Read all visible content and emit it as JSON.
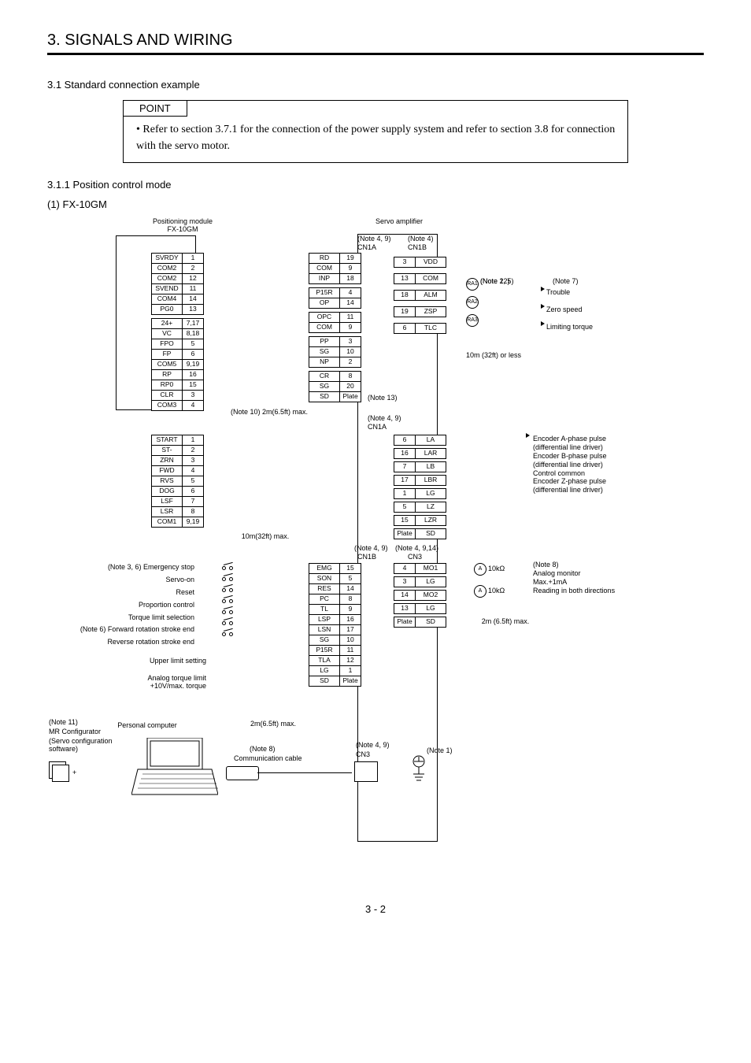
{
  "chapter_title": "3. SIGNALS AND WIRING",
  "section": "3.1 Standard connection example",
  "point": {
    "label": "POINT",
    "text": "Refer to section 3.7.1 for the connection of the power supply system and refer to section 3.8 for connection with the servo motor."
  },
  "subsection": "3.1.1 Position control mode",
  "device": "(1) FX-10GM",
  "page_footer": "3 - 2",
  "labels": {
    "positioning_module": "Positioning module\nFX-10GM",
    "servo_amplifier": "Servo amplifier",
    "note49a": "(Note 4, 9)",
    "note4": "(Note 4)",
    "cn1a": "CN1A",
    "cn1b": "CN1B",
    "note12": "(Note 12)",
    "note25": "(Note 2, 5)",
    "note7": "(Note 7)",
    "trouble": "Trouble",
    "zero_speed": "Zero speed",
    "limit_torque": "Limiting torque",
    "cable_top": "10m (32ft) or less",
    "note13": "(Note 13)",
    "note49b": "(Note 4, 9)",
    "note10_len": "(Note 10) 2m(6.5ft) max.",
    "ten_m": "10m(32ft) max.",
    "enc_a": "Encoder A-phase pulse",
    "diff": "(differential line driver)",
    "enc_b": "Encoder B-phase pulse",
    "ctrl_common": "Control common",
    "enc_z": "Encoder Z-phase pulse",
    "note36": "(Note 3, 6) Emergency stop",
    "servo_on": "Servo-on",
    "reset": "Reset",
    "prop": "Proportion control",
    "tlsel": "Torque limit selection",
    "note6_fwd": "(Note 6) Forward rotation stroke end",
    "rev_end": "Reverse rotation stroke end",
    "upper_limit": "Upper limit setting",
    "analog_tl": "Analog torque limit\n+10V/max. torque",
    "note49c": "(Note 4, 9)",
    "note4914": "(Note 4, 9,14)",
    "cn3": "CN3",
    "note8": "(Note 8)",
    "analog_mon": "Analog monitor",
    "max1ma": "Max.+1mA",
    "read_both": "Reading in both directions",
    "two_m": "2m (6.5ft) max.",
    "two_m_b": "2m(6.5ft) max.",
    "note11": "(Note 11)",
    "mrconf": "MR Configurator",
    "servo_conf": "(Servo configuration software)",
    "personal_computer": "Personal computer",
    "note8b": "(Note 8)",
    "comm_cable": "Communication cable",
    "note49d": "(Note 4, 9)",
    "note1": "(Note 1)",
    "ra1": "RA1",
    "ra2": "RA2",
    "ra3": "RA3",
    "a": "A",
    "ohm": "10kΩ",
    "plus": "+"
  },
  "left_rows": [
    {
      "sig": "SVRDY",
      "pin": "1"
    },
    {
      "sig": "COM2",
      "pin": "2"
    },
    {
      "sig": "COM2",
      "pin": "12"
    },
    {
      "sig": "SVEND",
      "pin": "11"
    },
    {
      "sig": "COM4",
      "pin": "14"
    },
    {
      "sig": "PG0",
      "pin": "13"
    },
    {
      "sig": "",
      "pin": ""
    },
    {
      "sig": "24+",
      "pin": "7,17"
    },
    {
      "sig": "VC",
      "pin": "8,18"
    },
    {
      "sig": "FPO",
      "pin": "5"
    },
    {
      "sig": "FP",
      "pin": "6"
    },
    {
      "sig": "COM5",
      "pin": "9,19"
    },
    {
      "sig": "RP",
      "pin": "16"
    },
    {
      "sig": "RP0",
      "pin": "15"
    },
    {
      "sig": "CLR",
      "pin": "3"
    },
    {
      "sig": "COM3",
      "pin": "4"
    }
  ],
  "cn1a_top": [
    {
      "sig": "RD",
      "pin": "19"
    },
    {
      "sig": "COM",
      "pin": "9"
    },
    {
      "sig": "INP",
      "pin": "18"
    },
    {
      "sig": "",
      "pin": ""
    },
    {
      "sig": "P15R",
      "pin": "4"
    },
    {
      "sig": "OP",
      "pin": "14"
    },
    {
      "sig": "",
      "pin": ""
    },
    {
      "sig": "OPC",
      "pin": "11"
    },
    {
      "sig": "COM",
      "pin": "9"
    },
    {
      "sig": "",
      "pin": ""
    },
    {
      "sig": "PP",
      "pin": "3"
    },
    {
      "sig": "SG",
      "pin": "10"
    },
    {
      "sig": "NP",
      "pin": "2"
    },
    {
      "sig": "",
      "pin": ""
    },
    {
      "sig": "CR",
      "pin": "8"
    },
    {
      "sig": "SG",
      "pin": "20"
    },
    {
      "sig": "SD",
      "pin": "Plate"
    }
  ],
  "cn1b_top": [
    {
      "pin": "3",
      "sig": "VDD"
    },
    {
      "pin": "13",
      "sig": "COM"
    },
    {
      "pin": "18",
      "sig": "ALM"
    },
    {
      "pin": "19",
      "sig": "ZSP"
    },
    {
      "pin": "6",
      "sig": "TLC"
    }
  ],
  "left2": [
    {
      "sig": "START",
      "pin": "1"
    },
    {
      "sig": "ST-",
      "pin": "2"
    },
    {
      "sig": "ZRN",
      "pin": "3"
    },
    {
      "sig": "FWD",
      "pin": "4"
    },
    {
      "sig": "RVS",
      "pin": "5"
    },
    {
      "sig": "DOG",
      "pin": "6"
    },
    {
      "sig": "LSF",
      "pin": "7"
    },
    {
      "sig": "LSR",
      "pin": "8"
    },
    {
      "sig": "COM1",
      "pin": "9,19"
    }
  ],
  "cn1a_enc": [
    {
      "pin": "6",
      "sig": "LA"
    },
    {
      "pin": "16",
      "sig": "LAR"
    },
    {
      "pin": "7",
      "sig": "LB"
    },
    {
      "pin": "17",
      "sig": "LBR"
    },
    {
      "pin": "1",
      "sig": "LG"
    },
    {
      "pin": "5",
      "sig": "LZ"
    },
    {
      "pin": "15",
      "sig": "LZR"
    },
    {
      "pin": "Plate",
      "sig": "SD"
    }
  ],
  "cn1b_bot": [
    {
      "sig": "EMG",
      "pin": "15"
    },
    {
      "sig": "SON",
      "pin": "5"
    },
    {
      "sig": "RES",
      "pin": "14"
    },
    {
      "sig": "PC",
      "pin": "8"
    },
    {
      "sig": "TL",
      "pin": "9"
    },
    {
      "sig": "LSP",
      "pin": "16"
    },
    {
      "sig": "LSN",
      "pin": "17"
    },
    {
      "sig": "SG",
      "pin": "10"
    },
    {
      "sig": "P15R",
      "pin": "11"
    },
    {
      "sig": "TLA",
      "pin": "12"
    },
    {
      "sig": "LG",
      "pin": "1"
    },
    {
      "sig": "SD",
      "pin": "Plate"
    }
  ],
  "cn3_rows": [
    {
      "pin": "4",
      "sig": "MO1"
    },
    {
      "pin": "3",
      "sig": "LG"
    },
    {
      "pin": "14",
      "sig": "MO2"
    },
    {
      "pin": "13",
      "sig": "LG"
    },
    {
      "pin": "Plate",
      "sig": "SD"
    }
  ]
}
